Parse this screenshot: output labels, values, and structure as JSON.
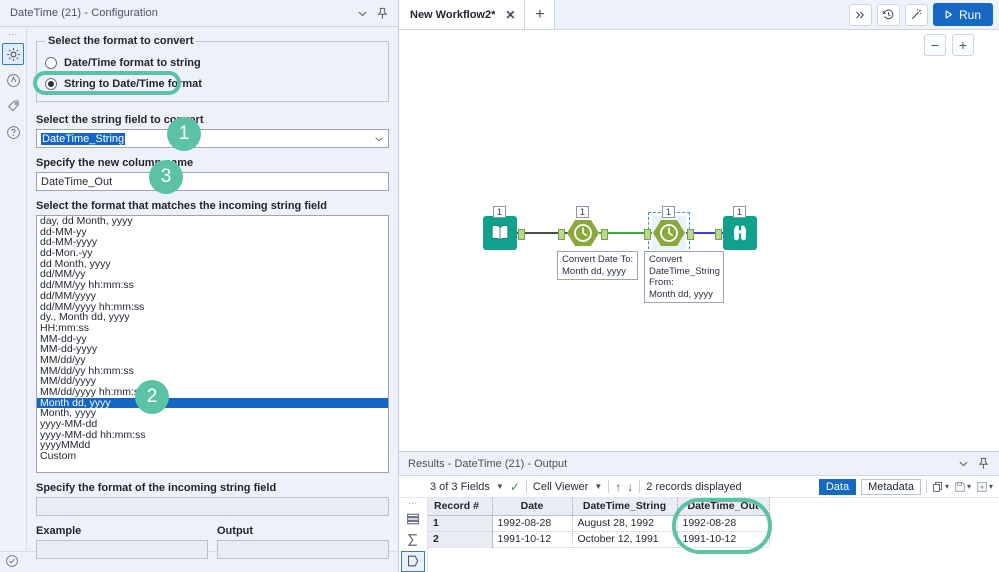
{
  "config": {
    "title": "DateTime (21) - Configuration",
    "collapse_icon": "chevron-down-icon",
    "pin_icon": "pin-icon",
    "rail": [
      {
        "name": "gear-icon",
        "selected": true
      },
      {
        "name": "annotation-icon",
        "selected": false
      },
      {
        "name": "tag-icon",
        "selected": false
      },
      {
        "name": "help-icon",
        "selected": false
      }
    ],
    "group_legend": "Select the format to convert",
    "radios": [
      {
        "label": "Date/Time format to string",
        "checked": false
      },
      {
        "label": "String to Date/Time format",
        "checked": true
      }
    ],
    "field_label": "Select the string field to convert",
    "field_value": "DateTime_String",
    "new_col_label": "Specify the new column name",
    "new_col_value": "DateTime_Out",
    "format_label": "Select the format that matches the incoming string field",
    "formats": [
      "day, dd Month, yyyy",
      "dd-MM-yy",
      "dd-MM-yyyy",
      "dd-Mon.-yy",
      "dd Month, yyyy",
      "dd/MM/yy",
      "dd/MM/yy hh:mm:ss",
      "dd/MM/yyyy",
      "dd/MM/yyyy hh:mm:ss",
      "dy., Month dd, yyyy",
      "HH:mm:ss",
      "MM-dd-yy",
      "MM-dd-yyyy",
      "MM/dd/yy",
      "MM/dd/yy hh:mm:ss",
      "MM/dd/yyyy",
      "MM/dd/yyyy hh:mm:ss",
      "Month dd, yyyy",
      "Month, yyyy",
      "yyyy-MM-dd",
      "yyyy-MM-dd hh:mm:ss",
      "yyyyMMdd",
      "Custom"
    ],
    "selected_format": "Month dd, yyyy",
    "incoming_label": "Specify the format of the incoming string field",
    "incoming_value": "",
    "example_label": "Example",
    "example_value": "",
    "output_label": "Output",
    "output_value": "",
    "footer_icon": "check-circle-icon"
  },
  "annotations": {
    "accent_color": "#5cc2a5",
    "badges": [
      {
        "number": "1",
        "target": "field_value"
      },
      {
        "number": "2",
        "target": "selected_format"
      },
      {
        "number": "3",
        "target": "new_col_value"
      }
    ],
    "ovals": [
      "string-to-datetime-radio",
      "datetime-out-column"
    ]
  },
  "tabbar": {
    "tab_label": "New Workflow2*",
    "close_icon": "close-icon",
    "add_icon": "plus-icon",
    "buttons": [
      {
        "name": "chevron-double-right-icon"
      },
      {
        "name": "history-icon"
      },
      {
        "name": "magic-wand-icon"
      }
    ],
    "run_label": "Run",
    "run_icon": "play-icon",
    "run_color": "#1668c3"
  },
  "canvas": {
    "zoom_out": "−",
    "zoom_in": "+",
    "nodes": [
      {
        "name": "input-data-tool",
        "badge": "1",
        "icon": "book-icon",
        "selected": false
      },
      {
        "name": "datetime-tool-1",
        "badge": "1",
        "icon": "clock-icon",
        "selected": false
      },
      {
        "name": "datetime-tool-2",
        "badge": "1",
        "icon": "clock-icon",
        "selected": true
      },
      {
        "name": "browse-tool",
        "badge": "1",
        "icon": "binoculars-icon",
        "selected": false
      }
    ],
    "notes": [
      "Convert Date To:\nMonth dd, yyyy",
      "Convert\nDateTime_String\nFrom:\nMonth dd, yyyy"
    ]
  },
  "results": {
    "title": "Results - DateTime (21) - Output",
    "collapse_icon": "chevron-down-icon",
    "pin_icon": "pin-icon",
    "fields_label": "3 of 3 Fields",
    "cell_viewer_label": "Cell Viewer",
    "records_label": "2 records displayed",
    "up_icon": "arrow-up-icon",
    "down_icon": "arrow-down-icon",
    "check_icon": "check-icon",
    "tab_data": "Data",
    "tab_metadata": "Metadata",
    "icons": [
      "copy-icon",
      "save-icon",
      "add-icon"
    ],
    "rail": [
      {
        "name": "records-icon",
        "selected": false
      },
      {
        "name": "summary-icon",
        "selected": false
      },
      {
        "name": "profile-icon",
        "selected": true
      }
    ],
    "columns": [
      "Record #",
      "Date",
      "DateTime_String",
      "DateTime_Out"
    ],
    "rows": [
      [
        "1",
        "1992-08-28",
        "August 28, 1992",
        "1992-08-28"
      ],
      [
        "2",
        "1991-10-12",
        "October 12, 1991",
        "1991-10-12"
      ]
    ]
  }
}
